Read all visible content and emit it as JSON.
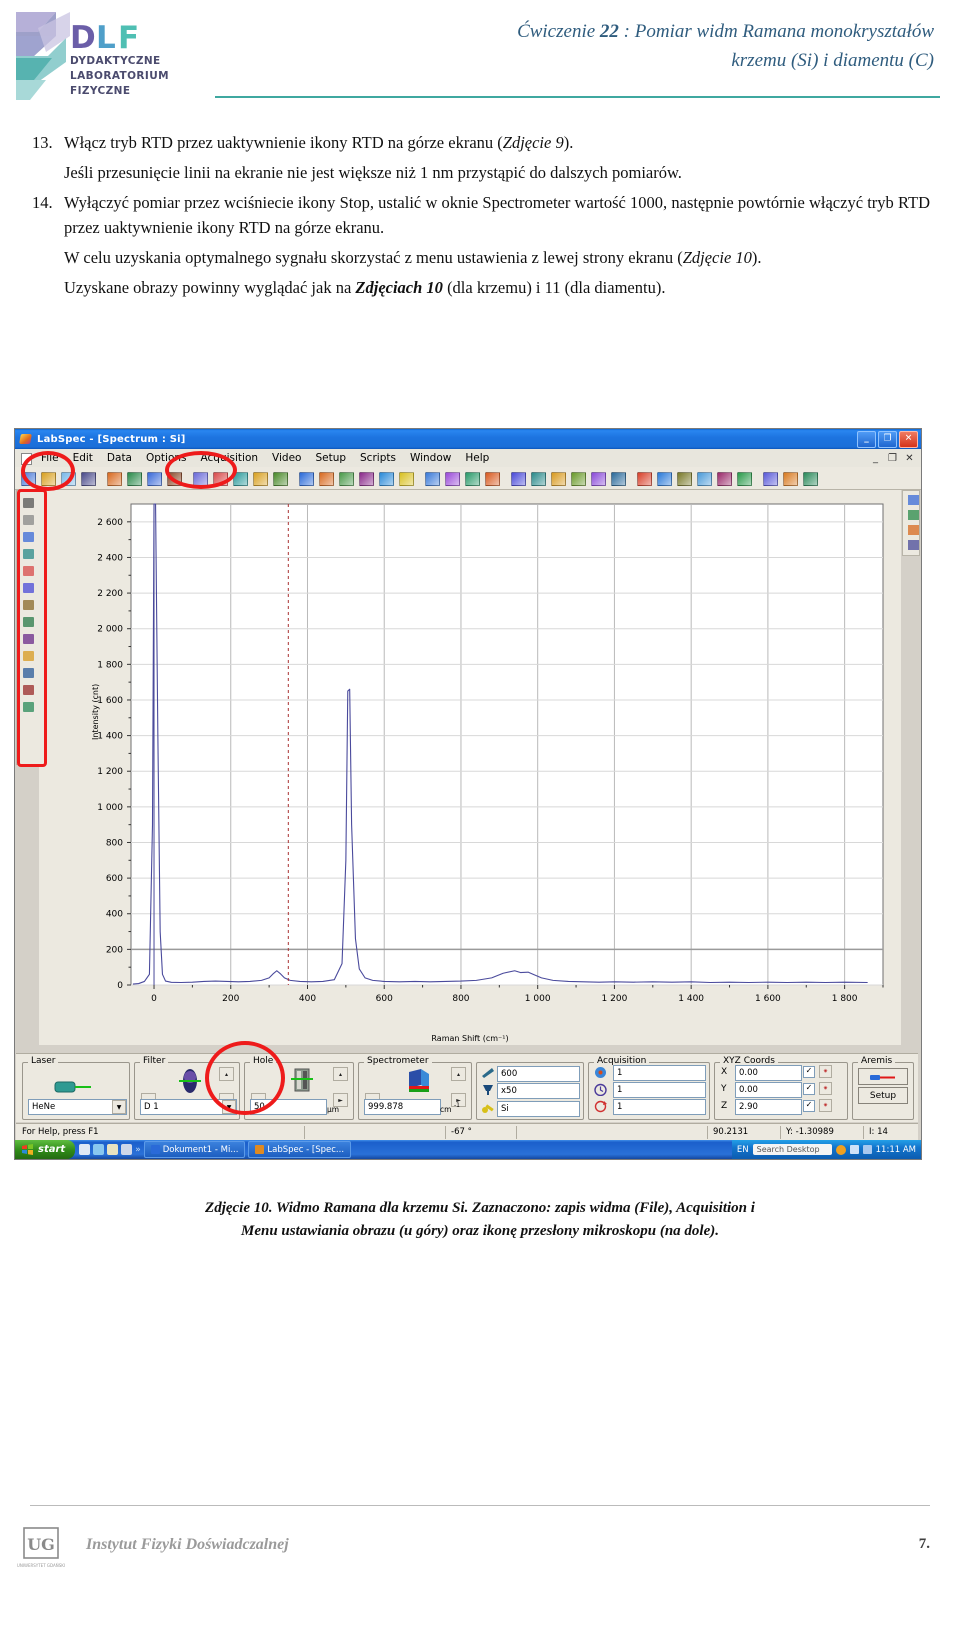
{
  "header": {
    "logo_main": "DLF",
    "logo_l1": "DYDAKTYCZNE",
    "logo_l2": "LABORATORIUM",
    "logo_l3": "FIZYCZNE",
    "title_pre": "Ćwiczenie ",
    "title_num": "22",
    "title_mid": " : Pomiar widm Ramana monokryształów",
    "title_line2": "krzemu (Si) i diamentu (C)",
    "accent": "#2f5c7e",
    "rule_color": "#3fa8a0"
  },
  "content": {
    "item13_num": "13.",
    "item13_text_a": "Włącz tryb RTD przez uaktywnienie ikony RTD na górze ekranu (",
    "item13_italic": "Zdjęcie 9",
    "item13_text_b": ").",
    "para13b": "Jeśli przesunięcie linii na ekranie nie jest większe niż 1 nm przystąpić do dalszych pomiarów.",
    "item14_num": "14.",
    "item14_text": "Wyłączyć pomiar przez wciśniecie ikony Stop, ustalić w oknie Spectrometer wartość 1000, następnie powtórnie włączyć tryb RTD przez uaktywnienie ikony RTD na górze ekranu.",
    "para14b_a": "W celu uzyskania optymalnego sygnału skorzystać z menu ustawienia z lewej strony ekranu (",
    "para14b_italic": "Zdjęcie 10",
    "para14b_b": ").",
    "para14c_a": "Uzyskane obrazy powinny wyglądać jak na ",
    "para14c_italic": "Zdjęciach 10",
    "para14c_b": " (dla krzemu) i 11 (dla diamentu)."
  },
  "screenshot": {
    "titlebar": {
      "title": "LabSpec - [Spectrum : Si]",
      "minimize": "_",
      "restore": "❐",
      "close": "✕"
    },
    "menu": {
      "items": [
        "File",
        "Edit",
        "Data",
        "Options",
        "Acquisition",
        "Video",
        "Setup",
        "Scripts",
        "Window",
        "Help"
      ],
      "mdi_minimize": "_",
      "mdi_restore": "❐",
      "mdi_close": "✕"
    },
    "plot": {
      "y_label": "Intensity (cnt)",
      "x_label": "Raman Shift (cm⁻¹)"
    },
    "controls": {
      "laser_caption": "Laser",
      "laser_value": "HeNe",
      "filter_caption": "Filter",
      "filter_value": "D 1",
      "hole_caption": "Hole",
      "hole_value": "50",
      "hole_unit": "µm",
      "spectrometer_caption": "Spectrometer",
      "spectrometer_value": "999.878",
      "spectrometer_unit": "cm",
      "spectrometer_unit_sup": "-1",
      "grating_value": "600",
      "objective_value": "x50",
      "sample_value": "Si",
      "acquisition_caption": "Acquisition",
      "acq_time": "1",
      "acq_delay": "1",
      "acq_accum": "1",
      "xyz_caption": "XYZ Coords",
      "x_label": "X",
      "x_value": "0.00",
      "y_label": "Y",
      "y_value": "0.00",
      "z_label": "Z",
      "z_value": "2.90",
      "aremis_caption": "Aremis",
      "aremis_setup": "Setup",
      "spin_up": "▴",
      "spin_down": "▾",
      "arrow_left": "◄",
      "arrow_right": "►",
      "check": "✓"
    },
    "statusbar": {
      "help": "For Help, press F1",
      "angle": "-67 °",
      "x_coord": "90.2131",
      "y_coord": "Y: -1.30989",
      "i_value": "I: 14"
    },
    "taskbar": {
      "start": "start",
      "tasks": [
        "Dokument1 - Mi...",
        "LabSpec - [Spec..."
      ],
      "lang": "EN",
      "search": "Search Desktop",
      "clock": "11:11 AM"
    }
  },
  "chart_data": {
    "type": "line",
    "title": "",
    "xlabel": "Raman Shift (cm⁻¹)",
    "ylabel": "Intensity (cnt)",
    "xlim": [
      -60,
      1900
    ],
    "ylim": [
      0,
      2700
    ],
    "xticks": [
      0,
      200,
      400,
      600,
      800,
      1000,
      1200,
      1400,
      1600,
      1800
    ],
    "xtick_labels": [
      "0",
      "200",
      "400",
      "600",
      "800",
      "1 000",
      "1 200",
      "1 400",
      "1 600",
      "1 800"
    ],
    "yticks": [
      0,
      200,
      400,
      600,
      800,
      1000,
      1200,
      1400,
      1600,
      1800,
      2000,
      2200,
      2400,
      2600
    ],
    "ytick_labels": [
      "0",
      "200",
      "400",
      "600",
      "800",
      "1 000",
      "1 200",
      "1 400",
      "1 600",
      "1 800",
      "2 000",
      "2 200",
      "2 400",
      "2 600"
    ],
    "grid": true,
    "legend": "none",
    "series": [
      {
        "name": "Spectrum : Si",
        "color": "#4a4a9c",
        "points": [
          [
            -55,
            5
          ],
          [
            -40,
            8
          ],
          [
            -25,
            20
          ],
          [
            -12,
            60
          ],
          [
            -4,
            900
          ],
          [
            0,
            2700
          ],
          [
            4,
            2700
          ],
          [
            10,
            1400
          ],
          [
            16,
            300
          ],
          [
            22,
            60
          ],
          [
            30,
            22
          ],
          [
            45,
            15
          ],
          [
            70,
            14
          ],
          [
            100,
            16
          ],
          [
            130,
            20
          ],
          [
            160,
            22
          ],
          [
            190,
            20
          ],
          [
            220,
            18
          ],
          [
            250,
            20
          ],
          [
            280,
            26
          ],
          [
            300,
            40
          ],
          [
            310,
            62
          ],
          [
            320,
            80
          ],
          [
            330,
            62
          ],
          [
            340,
            40
          ],
          [
            355,
            26
          ],
          [
            380,
            20
          ],
          [
            410,
            18
          ],
          [
            440,
            20
          ],
          [
            470,
            30
          ],
          [
            490,
            120
          ],
          [
            500,
            700
          ],
          [
            505,
            1650
          ],
          [
            510,
            1660
          ],
          [
            515,
            900
          ],
          [
            525,
            260
          ],
          [
            535,
            90
          ],
          [
            550,
            40
          ],
          [
            570,
            26
          ],
          [
            600,
            20
          ],
          [
            640,
            18
          ],
          [
            680,
            20
          ],
          [
            720,
            18
          ],
          [
            760,
            20
          ],
          [
            800,
            22
          ],
          [
            840,
            26
          ],
          [
            880,
            40
          ],
          [
            910,
            66
          ],
          [
            940,
            80
          ],
          [
            955,
            70
          ],
          [
            975,
            72
          ],
          [
            990,
            58
          ],
          [
            1010,
            40
          ],
          [
            1040,
            26
          ],
          [
            1080,
            20
          ],
          [
            1120,
            18
          ],
          [
            1160,
            16
          ],
          [
            1200,
            18
          ],
          [
            1250,
            16
          ],
          [
            1300,
            18
          ],
          [
            1350,
            16
          ],
          [
            1400,
            18
          ],
          [
            1450,
            14
          ],
          [
            1500,
            16
          ],
          [
            1550,
            14
          ],
          [
            1600,
            16
          ],
          [
            1650,
            14
          ],
          [
            1700,
            16
          ],
          [
            1750,
            14
          ],
          [
            1800,
            16
          ],
          [
            1860,
            14
          ]
        ]
      }
    ],
    "markers": [
      {
        "type": "vline",
        "x": 0,
        "style": "solid",
        "color": "#4a4a9c"
      },
      {
        "type": "vline",
        "x": 350,
        "style": "dashed",
        "color": "#aa3333"
      }
    ]
  },
  "caption": {
    "line1_a": "Zdjęcie 10. Widmo Ramana dla krzemu Si. Zaznaczono: zapis widma (File), Acquisition i",
    "line2": "Menu ustawiania obrazu (u góry) oraz ikonę przesłony mikroskopu (na dole)."
  },
  "footer": {
    "institute": "Instytut Fizyki Doświadczalnej",
    "logo_caption": "UNIWERSYTET GDAŃSKI",
    "page": "7."
  }
}
